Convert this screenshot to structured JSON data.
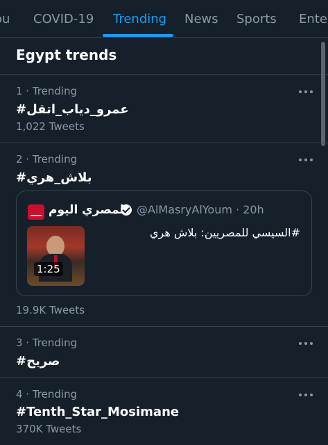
{
  "tabs": [
    "ou",
    "COVID-19",
    "Trending",
    "News",
    "Sports",
    "Ente"
  ],
  "active_tab": "Trending",
  "section_title": "Egypt trends",
  "trends": [
    {
      "meta": "1 · Trending",
      "name": "#عمرو_دياب_اتقل",
      "count": "1,022 Tweets"
    },
    {
      "meta": "2 · Trending",
      "name": "#بلاش_هري",
      "count": "19.9K Tweets"
    },
    {
      "meta": "3 · Trending",
      "name": "#صريح",
      "count": ""
    },
    {
      "meta": "4 · Trending",
      "name": "#Tenth_Star_Mosimane",
      "count": "370K Tweets"
    }
  ],
  "card": {
    "source_name": "المصري اليوم",
    "handle": "@AlMasryAlYoum · 20h",
    "text": "#السيسي للمصريين: بلاش هري",
    "video_duration": "1:25"
  },
  "icons": {
    "more": "more-horizontal-icon",
    "verified": "verified-badge-icon",
    "logo": "almasry-alyoum-logo"
  },
  "colors": {
    "background": "#15202b",
    "accent": "#1d9bf0",
    "muted": "#8b98a5",
    "divider": "#38444d"
  }
}
